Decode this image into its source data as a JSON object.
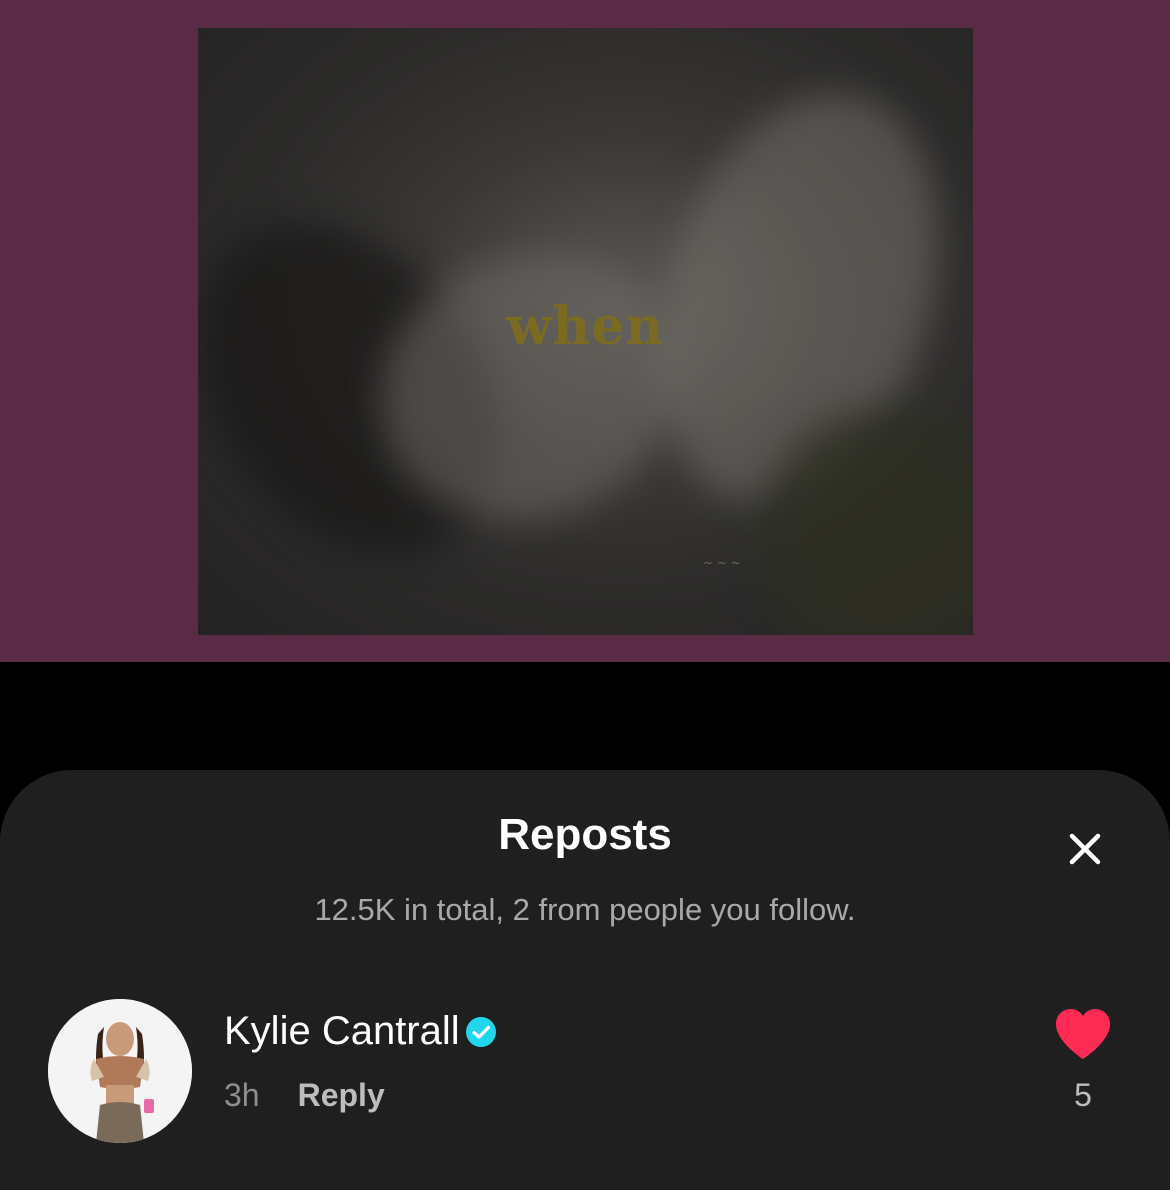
{
  "video": {
    "caption_word": "when"
  },
  "sheet": {
    "title": "Reposts",
    "subtitle": "12.5K in total, 2 from people you follow.",
    "close_icon": "close-icon"
  },
  "reposts": [
    {
      "username": "Kylie Cantrall",
      "verified": true,
      "time": "3h",
      "reply_label": "Reply",
      "like_count": "5",
      "like_icon": "heart-icon",
      "like_color": "#fe2c55"
    }
  ],
  "colors": {
    "video_background": "#5a2b45",
    "sheet_background": "#1f1f1f",
    "verified_badge": "#20d5ec",
    "heart": "#fe2c55"
  }
}
